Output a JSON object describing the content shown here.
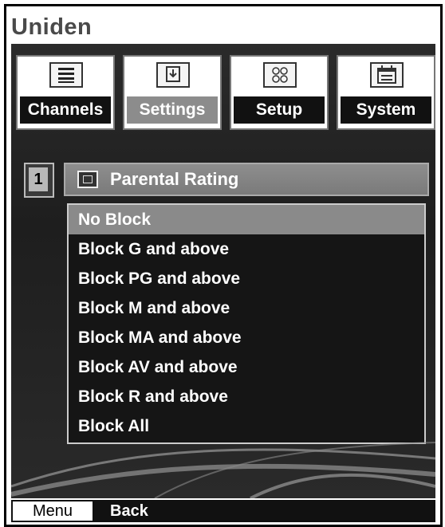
{
  "brand": "Uniden",
  "tabs": [
    {
      "label": "Channels",
      "icon": "list-icon"
    },
    {
      "label": "Settings",
      "icon": "download-box-icon",
      "active": true
    },
    {
      "label": "Setup",
      "icon": "grid-icon"
    },
    {
      "label": "System",
      "icon": "calendar-icon"
    }
  ],
  "menu": {
    "index": "1",
    "title": "Parental Rating",
    "title_icon": "rating-icon",
    "options": [
      "No Block",
      "Block G and above",
      "Block PG and above",
      "Block M and above",
      "Block MA and above",
      "Block AV and above",
      "Block R and above",
      "Block All"
    ],
    "selected": "No Block"
  },
  "footer": {
    "menu_label": "Menu",
    "back_label": "Back"
  }
}
